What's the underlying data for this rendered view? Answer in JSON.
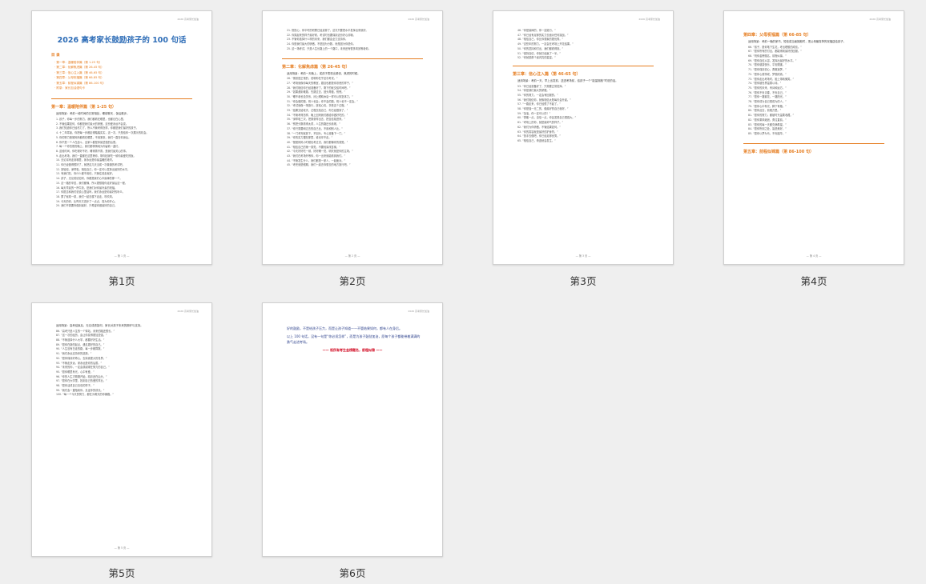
{
  "pages": [
    {
      "caption": "第1页",
      "header": "2026 高考家长加油",
      "footer": "— 第 1 页 —",
      "title": "2026 高考家长鼓励孩子的 100 句话",
      "toc_heading": "目 录",
      "toc": [
        "· 第一章：温暖陪伴篇（第 1-25 句）",
        "· 第二章：化解焦虑篇（第 26-45 句）",
        "· 第三章：信心注入篇（第 46-65 句）",
        "· 第四章：父母祝福篇（第 66-85 句）",
        "· 第五章：前程似锦篇（第 86-100 句）",
        "· 附录：家长加油语句卡"
      ],
      "section": "第一章：温暖陪伴篇（第 1-25 句）",
      "intro": "适用场景：考前一段时间的日常相处，睡前聊天，饭后散步。",
      "lines": [
        "1. 孩子，你每一步的努力，我们都看在眼里，也都记在心里。",
        "2. 不管结果如何，你都是我们最大的骄傲，这份爱永远不会变。",
        "3. 我们知道你已经尽力了，所以不管考得怎样，你都是我们最好的孩子。",
        "4. 十二年寒窗，你把每一步都走得踏踏实实，这一次，只是给你一次展示的机会。",
        "5. 你的努力爸爸妈妈都看在眼里，不用紧张，我们一直在你身后。",
        "6. 你不是一个人在战斗，全家人都是你最坚强的后盾。",
        "7. 每一个你熬夜的晚上，我们都悄悄地为你留着一盏灯。",
        "8. 这段时间，你吃得好不好，睡得香不香，是我们最关心的事。",
        "9. 走出考场，我们一直都在这里等你，带你回家吃一顿你最爱吃的饭。",
        "10. 无论将来走到哪里，家永远是你最温暖的港湾。",
        "11. 你已经做得很好了，就把这几天当成一次普通的考试吧。",
        "12. 放轻松，深呼吸，相信自己，你一定可以发挥出最好的水平。",
        "13. 有我们在，你什么都不用怕，只管往前走就好。",
        "14. 孩子，无论成绩如何，你都是我们心中最棒的那一个。",
        "15. 这一路的辛苦，我们都懂，所以更想陪你走好最后这一程。",
        "16. 每天早晨的一杯牛奶，是我们对你最朴素的祝福。",
        "17. 你愿意和我们说说心里话吗，我们永远是你最好的听众。",
        "18. 累了就歇一歇，我们一起去楼下走走，吹吹风。",
        "19. 今天的你，比昨天又进步了一点点，真为你开心。",
        "20. 我们不需要你做到最好，只希望你做最好的自己。"
      ]
    },
    {
      "caption": "第2页",
      "header": "2026 高考家长加油",
      "footer": "— 第 2 页 —",
      "lines_top": [
        "21. 别担心，你平时的积累已经足够了，这次只要把水平发挥出来就好。",
        "22. 你笑起来的样子最好看，考试时也要保持这份好心情哦。",
        "23. 不管你选择什么样的未来，我们都会全力支持你。",
        "24. 你是我们最大的骄傲，不是因为分数，而是因为你是你。",
        "25. 这一场考试，只是人生长路上的一个路口，未来还有很多风景等着你。"
      ],
      "section": "第二章：化解焦虑篇（第 26-45 句）",
      "intro": "适用场景：考前一天晚上，或孩子表现出紧张、焦虑的时候。",
      "lines": [
        "26. “紧张是正常的，说明你在乎这次考试。”",
        "27. “考场就像你每天的教室，题目也都是你熟悉的样子。”",
        "28. “我们相信你已经准备好了，剩下的就交给时间吧。”",
        "29. “如果遇到难题，先跳过去，回头再做，别慌。”",
        "30. “睡不着也没关系，闭上眼睛休息一样可以恢复体力。”",
        "31. “你会做的题，别人也会；你不会的题，别人也不一定会。”",
        "32. “考试就像一场旅行，放松心情，享受这个过程。”",
        "33. “结果交给老天，过程交给自己，你已经做到了。”",
        "34. “不管考得怎样，晚上回来我们都给你做好吃的。”",
        "35. “深呼吸三次，把紧张呼出去，把自信吸进来。”",
        "36. “别把分数看得太重，人生的路还长着呢。”",
        "37. “你只需要和过去的自己比，不用和别人比。”",
        "38. “一门考完就放下，不回头，专心准备下一门。”",
        "39. “你的实力摆在那里，谁也拿不走。”",
        "40. “爸爸妈妈小时候也考过试，我们都懂你的感受。”",
        "41. “相信自己的第一感觉，不要轻易改答案。”",
        "42. “今天好好吃一顿，好好睡一觉，明天就是你的主场。”",
        "43. “我们在考场外等你，你一出来就能看到我们。”",
        "44. “不管发生什么，我们都是一家人，一起面对。”",
        "45. “考完就是假期，我们一起去你想去的地方旅行吧。”"
      ]
    },
    {
      "caption": "第3页",
      "header": "2026 高考家长加油",
      "footer": "— 第 3 页 —",
      "lines_top": [
        "46. “你是最棒的，你一定能行。”",
        "47. “你已经有足够的实力去面对任何挑战。”",
        "48. “相信自己，你比你想象的更优秀。”",
        "49. “这些年的努力，一定会在考场上开花结果。”",
        "50. “你的坚持和付出，我们都看得到。”",
        "51. “保持自信，你就已经赢了一半。”",
        "52. “你就是那个最闪亮的星星。”"
      ],
      "section": "第三章：信心注入篇（第 46-65 句）",
      "intro": "适用场景：考前一天，早上出发前，送进考场前，给孩子一个“能量拥抱”时说的话。",
      "lines": [
        "53. “你已经准备好了，只需要正常发挥。”",
        "54. “你是我们最大的骄傲。”",
        "55. “你的努力，一定会有回报的。”",
        "56. “我们相信你，就像相信太阳每天会升起。”",
        "57. “一路走来，你已经很了不起了。”",
        "58. “你是独一无二的，做最好的自己就好。”",
        "59. “加油，你一定可以的！”",
        "60. “勇敢一点，自信一点，你会发现自己很强大。”",
        "61. “考场上的你，就是最帅气的样子。”",
        "62. “我们为你骄傲，不管结果如何。”",
        "63. “你的笑容就是最好的护身符。”",
        "64. “放手去做吧，你已经足够优秀。”",
        "65. “相信自己，奇迹就会发生。”"
      ]
    },
    {
      "caption": "第4页",
      "header": "2026 高考家长加油",
      "footer": "— 第 4 页 —",
      "section": "第四章：父母祝福篇（第 66-85 句）",
      "intro": "适用场景：考前一晚的家书、短信或当面拥抱时，把父母最真挚的祝福送给孩子。",
      "lines": [
        "66. “孩子，愿你笔下生花，考出理想的成绩。”",
        "67. “愿你所有的付出，都能得到最好的回报。”",
        "68. “祝你金榜题名，前程似锦。”",
        "69. “愿你自信从容，发挥出最好的水平。”",
        "70. “愿你健康快乐，平安顺遂。”",
        "71. “愿你保持初心，勇敢追梦。”",
        "72. “愿你心想事成，梦想成真。”",
        "73. “愿你走出考场时，脸上带着微笑。”",
        "74. “愿你被世界温柔以待。”",
        "75. “愿你的未来，有诗和远方。”",
        "76. “愿你不负青春，不负自己。”",
        "77. “愿你一路繁花，一路阳光。”",
        "78. “愿你成为自己想成为的人。”",
        "79. “愿你心中有光，脚下有路。”",
        "80. “愿你此去，前程万里。”",
        "81. “愿你的努力，都被时光温柔收藏。”",
        "82. “愿你乘风破浪，勇往直前。”",
        "83. “愿你的每一天都充满希望。”",
        "84. “愿你所到之处，皆是美好。”",
        "85. “愿你以梦为马，不负韶华。”"
      ],
      "section2": "第五章：前程似锦篇（第 86-100 句）"
    },
    {
      "caption": "第5页",
      "header": "2026 高考家长加油",
      "footer": "— 第 5 页 —",
      "intro": "适用场景：高考结束后，无论成绩如何，家长对孩子未来的期许与支持。",
      "lines": [
        "86. “高考只是人生的一个驿站，未来的路还很长。”",
        "87. “这一次的经历，会让你变得更加坚强。”",
        "88. “不管选择什么大学，都要好好生活。”",
        "89. “愿你在新的起点，遇见更好的自己。”",
        "90. “人生没有白走的路，每一步都算数。”",
        "91. “我们永远支持你的选择。”",
        "92. “愿你保持好奇心，去探索更大的世界。”",
        "93. “不管走多远，家永远是你的后盾。”",
        "94. “未来的你，一定会感谢现在努力的自己。”",
        "95. “愿你眼里有光，心中有爱。”",
        "96. “你的人生才刚刚开始，精彩还在后头。”",
        "97. “愿你在大学里，找到自己热爱的事业。”",
        "98. “愿你活成自己喜欢的样子。”",
        "99. “我们会一直陪着你，见证你的成长。”",
        "100. “每一个今天的努力，都在为明天的你铺路。”"
      ]
    },
    {
      "caption": "第6页",
      "header": "2026 高考家长加油",
      "footer": "— 第 6 页 —",
      "closing": [
        "好的鼓励，不是给孩子压力，而是让孩子知道——不管结果如何，都有人在身后。",
        "以上 100 句话，没有一句是“你必须怎样”，而是为孩子鼓劲加油，愿每个孩子都能带着满满的勇气走进考场。"
      ],
      "closing_red": "—— 祝所有考生金榜题名，前程似锦 ——"
    }
  ]
}
